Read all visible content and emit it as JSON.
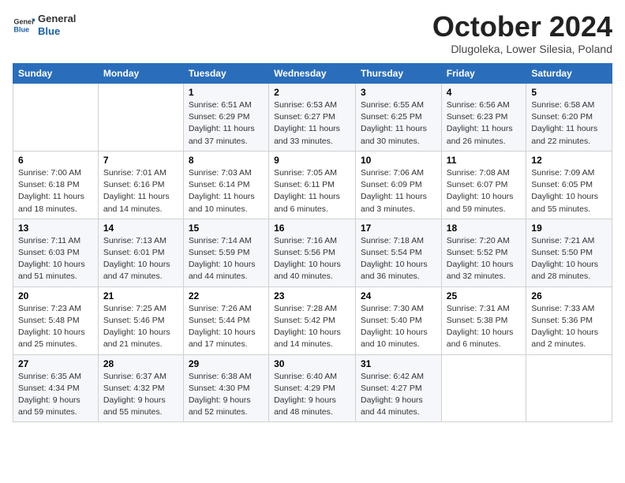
{
  "header": {
    "logo_general": "General",
    "logo_blue": "Blue",
    "month_title": "October 2024",
    "subtitle": "Dlugoleka, Lower Silesia, Poland"
  },
  "weekdays": [
    "Sunday",
    "Monday",
    "Tuesday",
    "Wednesday",
    "Thursday",
    "Friday",
    "Saturday"
  ],
  "weeks": [
    [
      {
        "day": "",
        "detail": ""
      },
      {
        "day": "",
        "detail": ""
      },
      {
        "day": "1",
        "detail": "Sunrise: 6:51 AM\nSunset: 6:29 PM\nDaylight: 11 hours\nand 37 minutes."
      },
      {
        "day": "2",
        "detail": "Sunrise: 6:53 AM\nSunset: 6:27 PM\nDaylight: 11 hours\nand 33 minutes."
      },
      {
        "day": "3",
        "detail": "Sunrise: 6:55 AM\nSunset: 6:25 PM\nDaylight: 11 hours\nand 30 minutes."
      },
      {
        "day": "4",
        "detail": "Sunrise: 6:56 AM\nSunset: 6:23 PM\nDaylight: 11 hours\nand 26 minutes."
      },
      {
        "day": "5",
        "detail": "Sunrise: 6:58 AM\nSunset: 6:20 PM\nDaylight: 11 hours\nand 22 minutes."
      }
    ],
    [
      {
        "day": "6",
        "detail": "Sunrise: 7:00 AM\nSunset: 6:18 PM\nDaylight: 11 hours\nand 18 minutes."
      },
      {
        "day": "7",
        "detail": "Sunrise: 7:01 AM\nSunset: 6:16 PM\nDaylight: 11 hours\nand 14 minutes."
      },
      {
        "day": "8",
        "detail": "Sunrise: 7:03 AM\nSunset: 6:14 PM\nDaylight: 11 hours\nand 10 minutes."
      },
      {
        "day": "9",
        "detail": "Sunrise: 7:05 AM\nSunset: 6:11 PM\nDaylight: 11 hours\nand 6 minutes."
      },
      {
        "day": "10",
        "detail": "Sunrise: 7:06 AM\nSunset: 6:09 PM\nDaylight: 11 hours\nand 3 minutes."
      },
      {
        "day": "11",
        "detail": "Sunrise: 7:08 AM\nSunset: 6:07 PM\nDaylight: 10 hours\nand 59 minutes."
      },
      {
        "day": "12",
        "detail": "Sunrise: 7:09 AM\nSunset: 6:05 PM\nDaylight: 10 hours\nand 55 minutes."
      }
    ],
    [
      {
        "day": "13",
        "detail": "Sunrise: 7:11 AM\nSunset: 6:03 PM\nDaylight: 10 hours\nand 51 minutes."
      },
      {
        "day": "14",
        "detail": "Sunrise: 7:13 AM\nSunset: 6:01 PM\nDaylight: 10 hours\nand 47 minutes."
      },
      {
        "day": "15",
        "detail": "Sunrise: 7:14 AM\nSunset: 5:59 PM\nDaylight: 10 hours\nand 44 minutes."
      },
      {
        "day": "16",
        "detail": "Sunrise: 7:16 AM\nSunset: 5:56 PM\nDaylight: 10 hours\nand 40 minutes."
      },
      {
        "day": "17",
        "detail": "Sunrise: 7:18 AM\nSunset: 5:54 PM\nDaylight: 10 hours\nand 36 minutes."
      },
      {
        "day": "18",
        "detail": "Sunrise: 7:20 AM\nSunset: 5:52 PM\nDaylight: 10 hours\nand 32 minutes."
      },
      {
        "day": "19",
        "detail": "Sunrise: 7:21 AM\nSunset: 5:50 PM\nDaylight: 10 hours\nand 28 minutes."
      }
    ],
    [
      {
        "day": "20",
        "detail": "Sunrise: 7:23 AM\nSunset: 5:48 PM\nDaylight: 10 hours\nand 25 minutes."
      },
      {
        "day": "21",
        "detail": "Sunrise: 7:25 AM\nSunset: 5:46 PM\nDaylight: 10 hours\nand 21 minutes."
      },
      {
        "day": "22",
        "detail": "Sunrise: 7:26 AM\nSunset: 5:44 PM\nDaylight: 10 hours\nand 17 minutes."
      },
      {
        "day": "23",
        "detail": "Sunrise: 7:28 AM\nSunset: 5:42 PM\nDaylight: 10 hours\nand 14 minutes."
      },
      {
        "day": "24",
        "detail": "Sunrise: 7:30 AM\nSunset: 5:40 PM\nDaylight: 10 hours\nand 10 minutes."
      },
      {
        "day": "25",
        "detail": "Sunrise: 7:31 AM\nSunset: 5:38 PM\nDaylight: 10 hours\nand 6 minutes."
      },
      {
        "day": "26",
        "detail": "Sunrise: 7:33 AM\nSunset: 5:36 PM\nDaylight: 10 hours\nand 2 minutes."
      }
    ],
    [
      {
        "day": "27",
        "detail": "Sunrise: 6:35 AM\nSunset: 4:34 PM\nDaylight: 9 hours\nand 59 minutes."
      },
      {
        "day": "28",
        "detail": "Sunrise: 6:37 AM\nSunset: 4:32 PM\nDaylight: 9 hours\nand 55 minutes."
      },
      {
        "day": "29",
        "detail": "Sunrise: 6:38 AM\nSunset: 4:30 PM\nDaylight: 9 hours\nand 52 minutes."
      },
      {
        "day": "30",
        "detail": "Sunrise: 6:40 AM\nSunset: 4:29 PM\nDaylight: 9 hours\nand 48 minutes."
      },
      {
        "day": "31",
        "detail": "Sunrise: 6:42 AM\nSunset: 4:27 PM\nDaylight: 9 hours\nand 44 minutes."
      },
      {
        "day": "",
        "detail": ""
      },
      {
        "day": "",
        "detail": ""
      }
    ]
  ]
}
